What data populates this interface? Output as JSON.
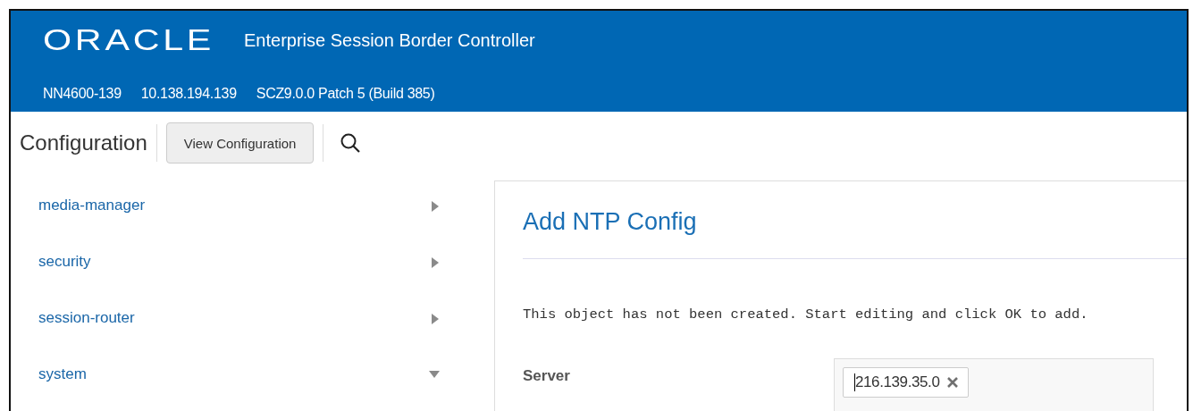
{
  "header": {
    "logo": "ORACLE",
    "product": "Enterprise Session Border Controller",
    "info": [
      "NN4600-139",
      "10.138.194.139",
      "SCZ9.0.0 Patch 5 (Build 385)"
    ]
  },
  "toolbar": {
    "title": "Configuration",
    "button": "View Configuration"
  },
  "sidebar": {
    "items": [
      {
        "label": "media-manager",
        "expanded": false
      },
      {
        "label": "security",
        "expanded": false
      },
      {
        "label": "session-router",
        "expanded": false
      },
      {
        "label": "system",
        "expanded": true
      }
    ]
  },
  "panel": {
    "title": "Add NTP Config",
    "message": "This object has not been created. Start editing and click OK to add.",
    "fields": [
      {
        "label": "Server",
        "values": [
          "216.139.35.0"
        ]
      }
    ]
  }
}
